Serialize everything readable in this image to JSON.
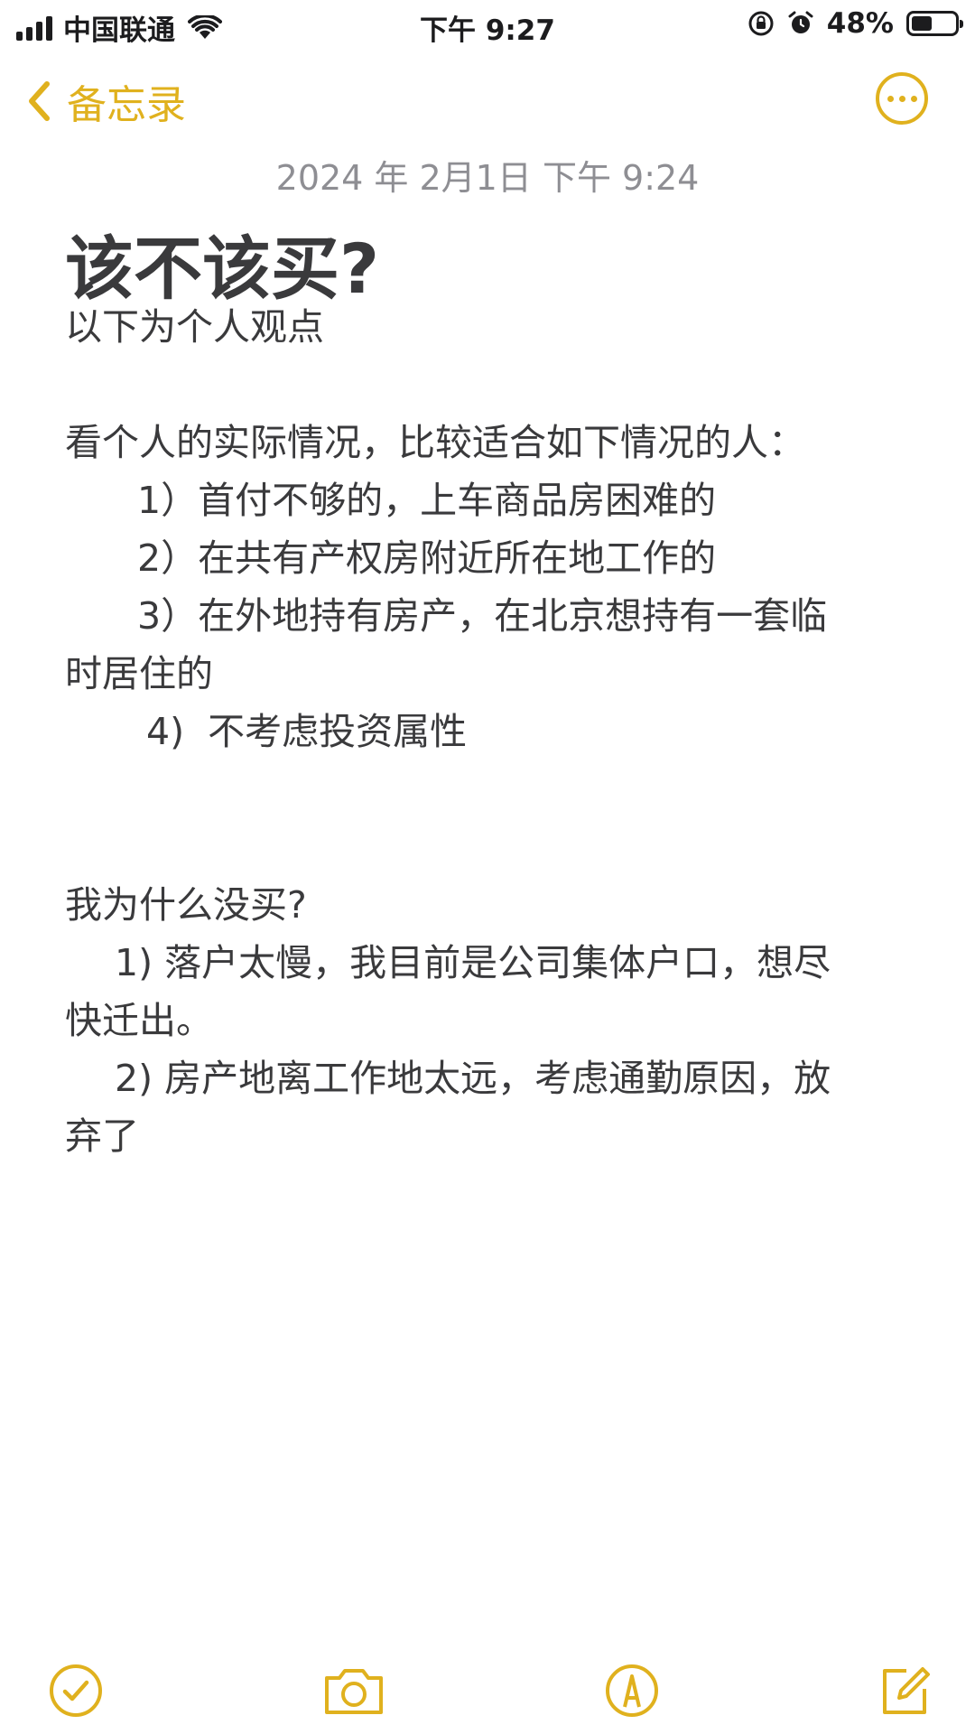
{
  "status_bar": {
    "carrier": "中国联通",
    "time": "下午 9:27",
    "battery_percent": "48%",
    "battery_level": 0.48,
    "icons": [
      "signal-icon",
      "wifi-icon",
      "orientation-lock-icon",
      "alarm-icon",
      "battery-icon"
    ]
  },
  "nav": {
    "back_label": "备忘录",
    "back_icon": "chevron-left-icon",
    "more_icon": "more-icon"
  },
  "note": {
    "date": "2024 年 2月1日 下午 9:24",
    "title": "该不该买?",
    "lines": {
      "l1": "以下为个人观点",
      "l2": "看个人的实际情况，比较适合如下情况的人：",
      "l3": "1）首付不够的，上车商品房困难的",
      "l4": "2）在共有产权房附近所在地工作的",
      "l5": "3）在外地持有房产，在北京想持有一套临",
      "l6": "时居住的",
      "l7": "4)  不考虑投资属性",
      "l8": "我为什么没买?",
      "l9": "1) 落户太慢，我目前是公司集体户口，想尽",
      "l10": "快迁出。",
      "l11": "2) 房产地离工作地太远，考虑通勤原因，放",
      "l12": "弃了"
    }
  },
  "toolbar": {
    "icons": [
      "checklist-icon",
      "camera-icon",
      "markup-icon",
      "compose-icon"
    ]
  },
  "colors": {
    "accent": "#e0b11e",
    "text": "#3a3a3c",
    "secondary": "#8e8e93",
    "background": "#ffffff"
  }
}
